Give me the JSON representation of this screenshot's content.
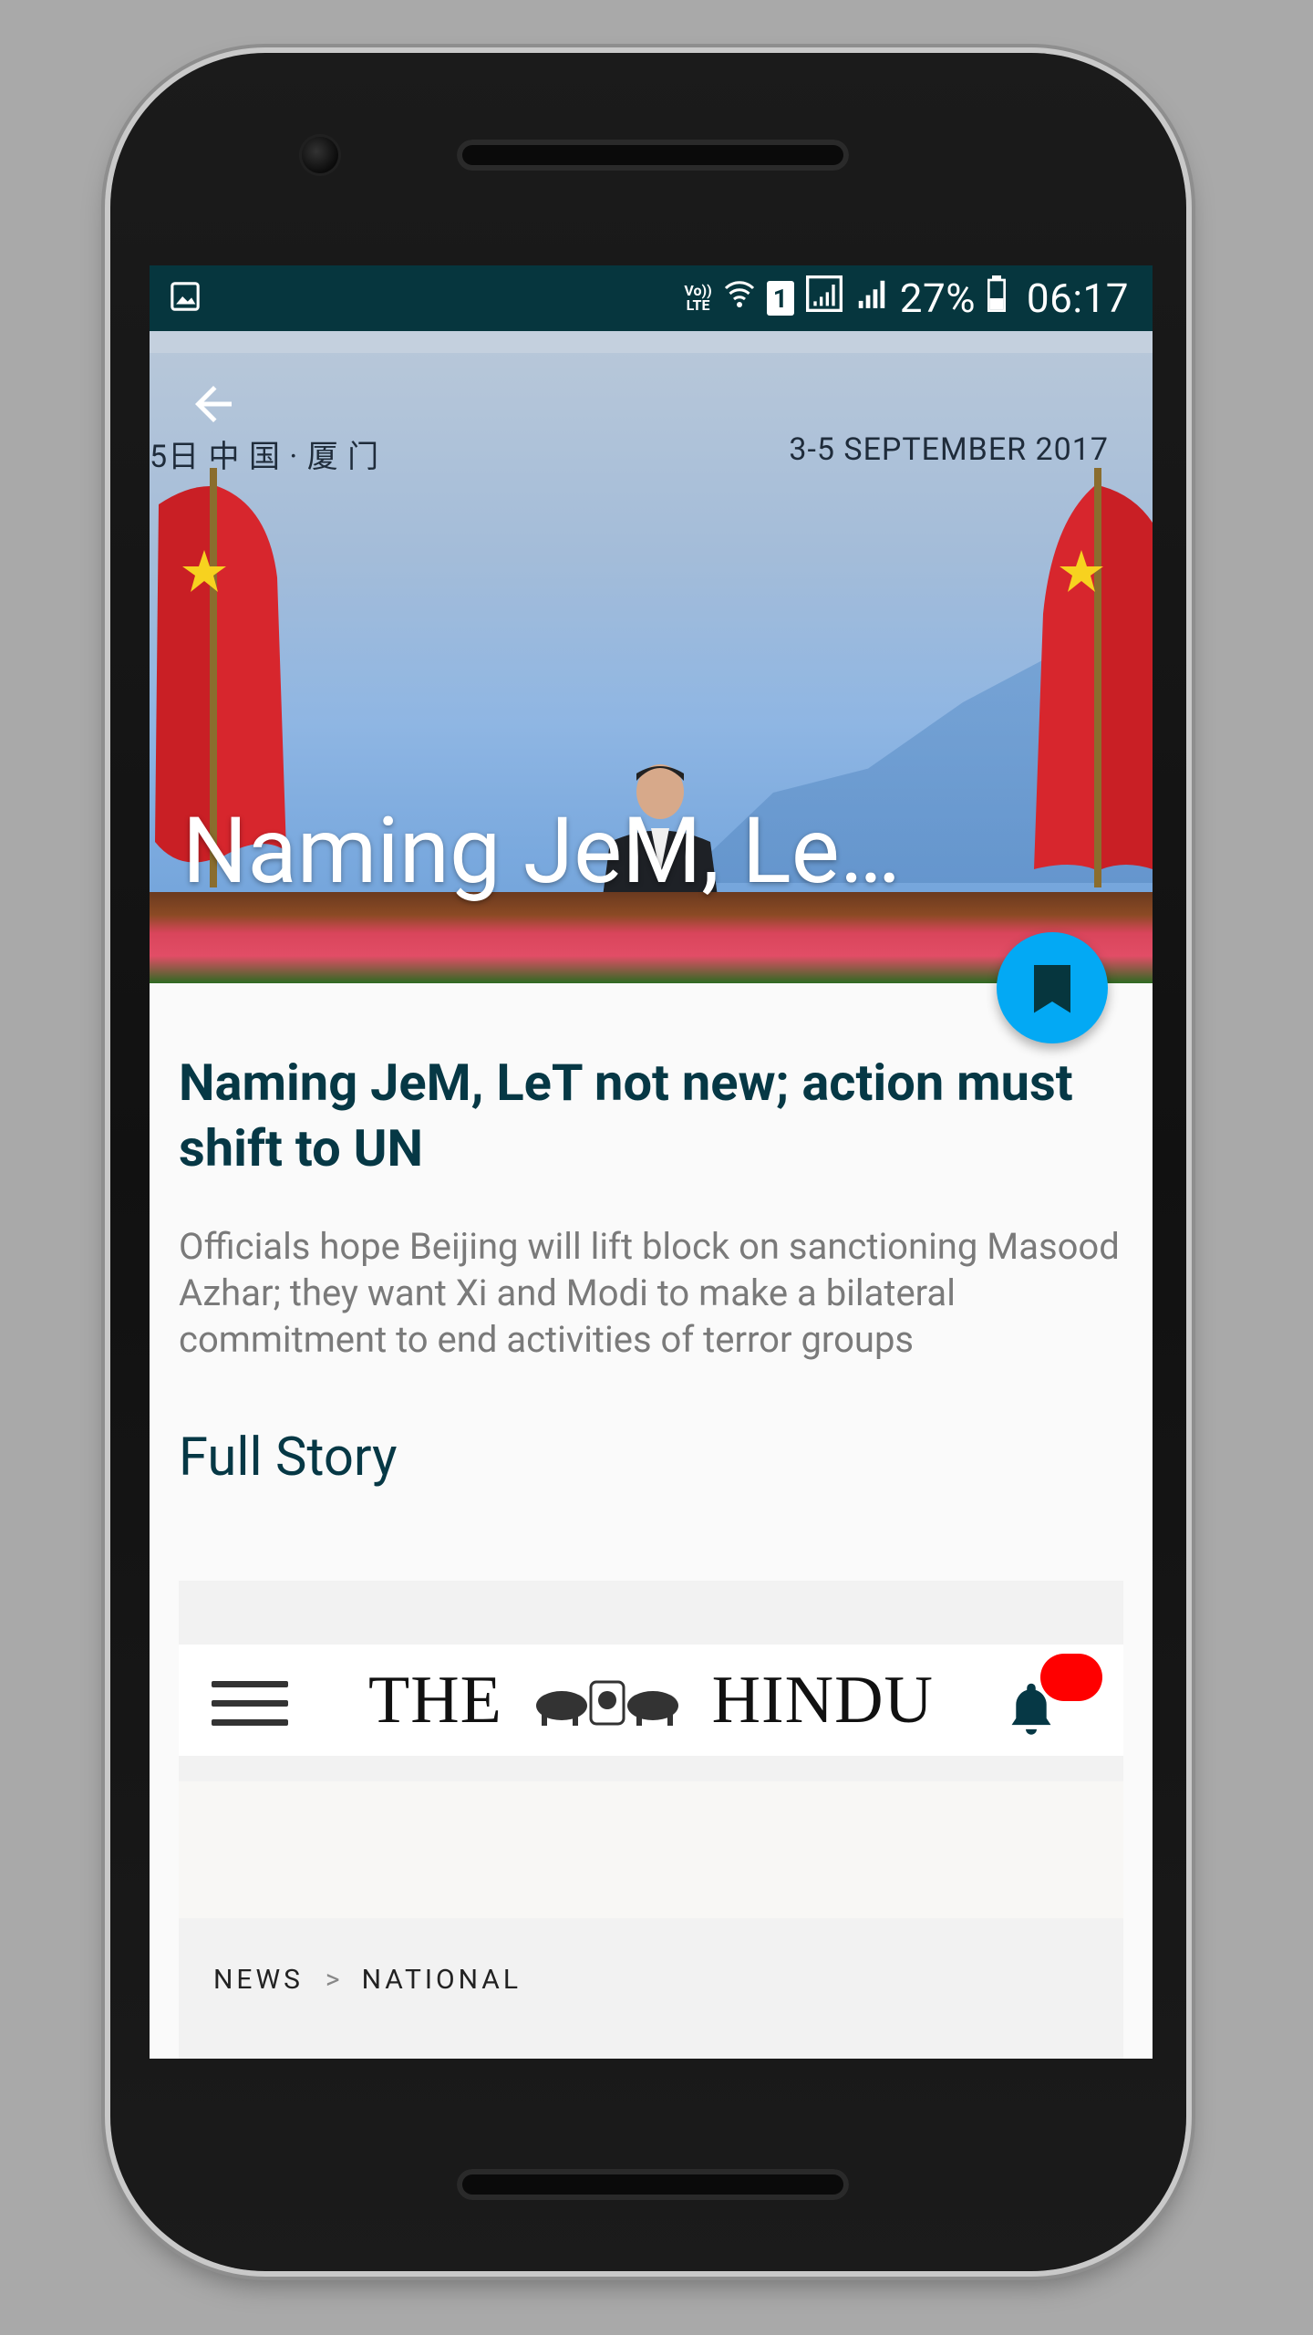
{
  "status_bar": {
    "volte_top": "Vo))",
    "volte_bottom": "LTE",
    "sim_badge": "1",
    "battery_percent": "27%",
    "time": "06:17"
  },
  "hero": {
    "event_city": "5日 中 国 · 厦 门",
    "event_date": "3-5 SEPTEMBER 2017",
    "title_overlay": "Naming JeM, Le…"
  },
  "article": {
    "headline": "Naming JeM, LeT not new; action must shift to UN",
    "summary": "Officials hope Beijing will lift block on sanctioning Masood Azhar; they want Xi and Modi to make a bilateral commitment to end activities of terror groups",
    "full_story_label": "Full Story"
  },
  "webview": {
    "logo_left": "THE",
    "logo_right": "HINDU",
    "breadcrumb": [
      "NEWS",
      "NATIONAL"
    ],
    "breadcrumb_separator": ">"
  },
  "colors": {
    "status_bar_bg": "#06363e",
    "headline": "#063845",
    "fab": "#03a9f4",
    "notification_dot": "#ff0000"
  },
  "icons": {
    "back": "arrow-left-icon",
    "bookmark": "bookmark-icon",
    "menu": "hamburger-menu-icon",
    "notifications": "bell-icon"
  }
}
